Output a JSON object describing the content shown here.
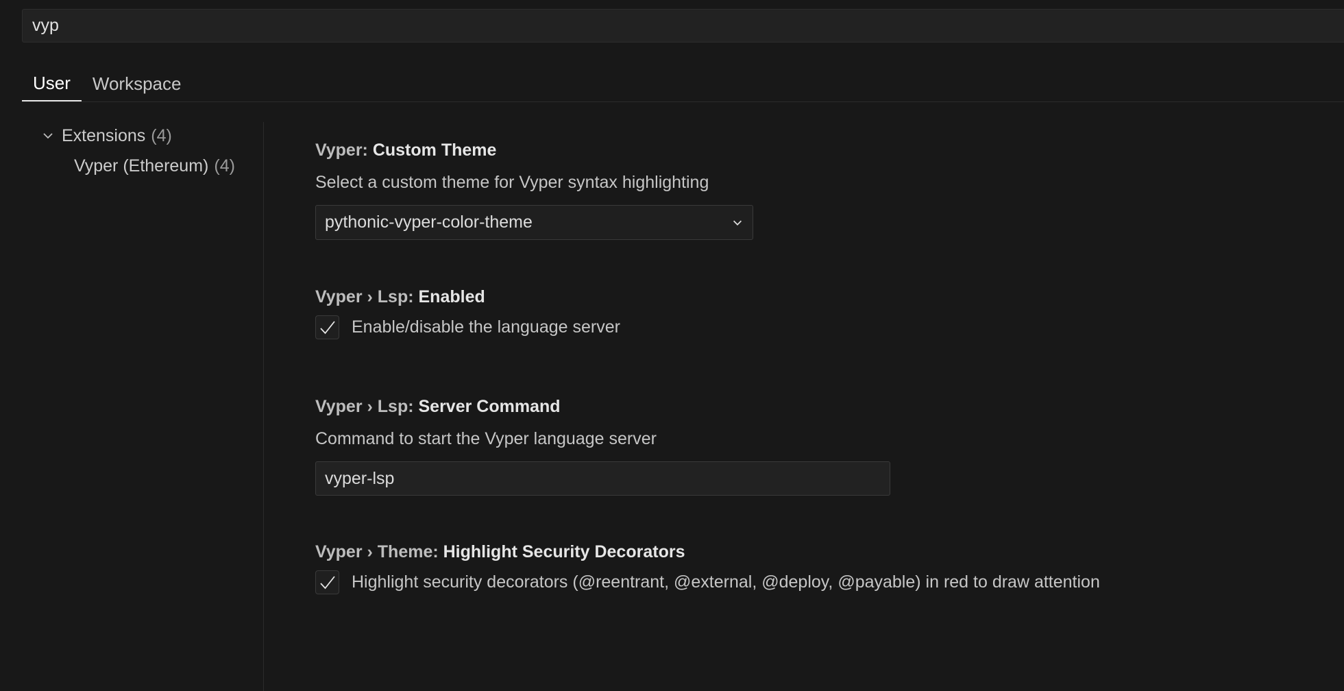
{
  "search": {
    "value": "vyp",
    "placeholder": ""
  },
  "tabs": [
    {
      "label": "User",
      "active": true
    },
    {
      "label": "Workspace",
      "active": false
    }
  ],
  "toc": {
    "group_label": "Extensions",
    "group_count": "(4)",
    "child_label": "Vyper (Ethereum)",
    "child_count": "(4)"
  },
  "settings": {
    "custom_theme": {
      "category": "Vyper: ",
      "name": "Custom Theme",
      "description": "Select a custom theme for Vyper syntax highlighting",
      "selected": "pythonic-vyper-color-theme"
    },
    "lsp_enabled": {
      "category": "Vyper › Lsp: ",
      "name": "Enabled",
      "checkbox_label": "Enable/disable the language server",
      "checked": true
    },
    "server_command": {
      "category": "Vyper › Lsp: ",
      "name": "Server Command",
      "description": "Command to start the Vyper language server",
      "value": "vyper-lsp"
    },
    "highlight_security": {
      "category": "Vyper › Theme: ",
      "name": "Highlight Security Decorators",
      "checkbox_label": "Highlight security decorators (@reentrant, @external, @deploy, @payable) in red to draw attention",
      "checked": true
    }
  },
  "colors": {
    "background": "#181818",
    "input_bg": "#222222",
    "border": "#3a3a3a",
    "text": "#cccccc",
    "active_tab_underline": "#e7e7e7"
  }
}
